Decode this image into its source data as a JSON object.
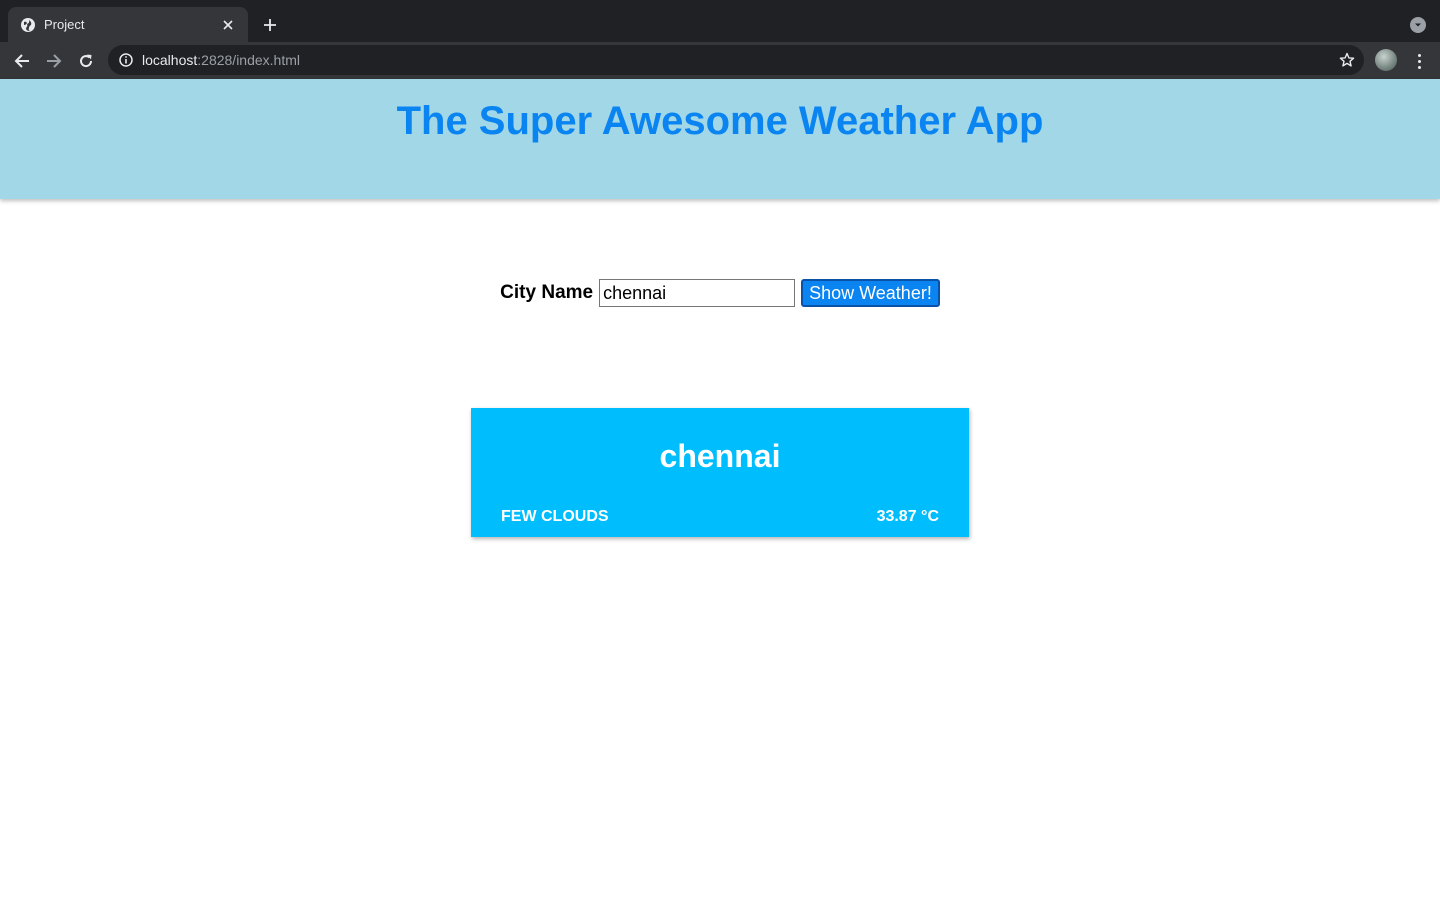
{
  "browser": {
    "tab_title": "Project",
    "url_host": "localhost",
    "url_rest": ":2828/index.html",
    "icons": {
      "favicon": "globe-icon",
      "close": "close-icon",
      "new_tab": "plus-icon",
      "tab_search": "chevron-down-icon",
      "back": "arrow-left-icon",
      "forward": "arrow-right-icon",
      "reload": "reload-icon",
      "site_info": "info-icon",
      "bookmark": "star-icon",
      "menu": "vertical-dots-icon"
    }
  },
  "header": {
    "title": "The Super Awesome Weather App"
  },
  "form": {
    "label": "City Name",
    "input_value": "chennai",
    "button_label": "Show Weather!"
  },
  "weather_card": {
    "city": "chennai",
    "description": "FEW CLOUDS",
    "temperature": "33.87 °C"
  },
  "colors": {
    "header_bg": "#a2d7e8",
    "title_color": "#0a84f0",
    "card_bg": "#00bdfd",
    "button_bg": "#0a84f0"
  }
}
